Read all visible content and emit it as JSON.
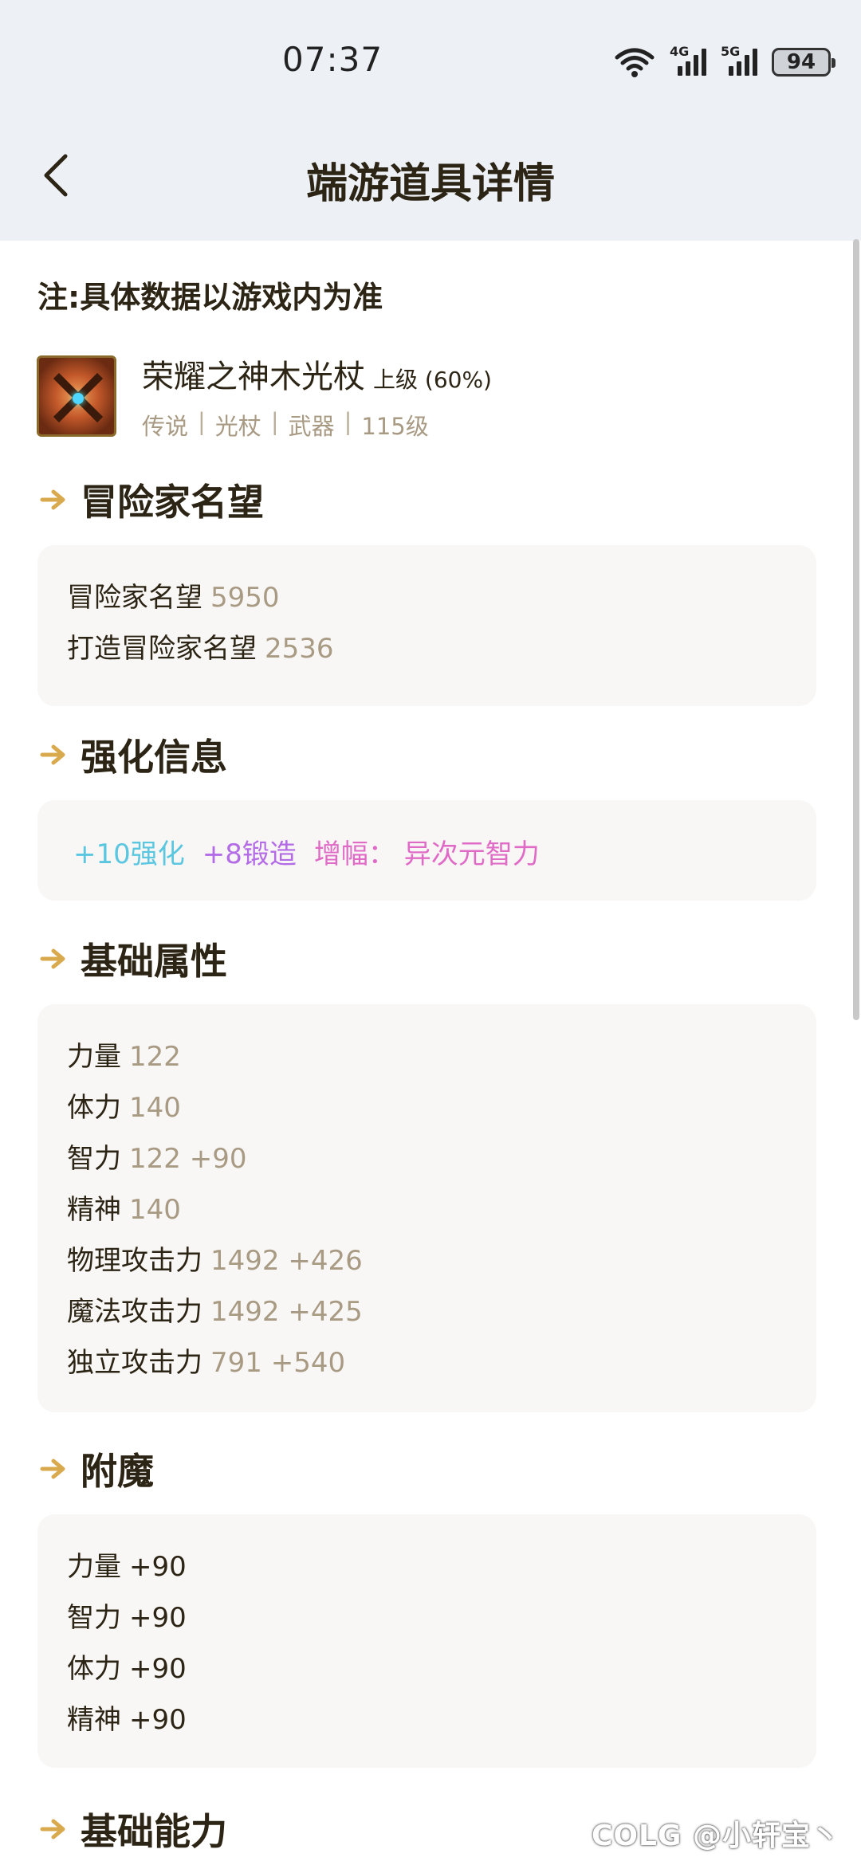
{
  "status": {
    "time": "07:37",
    "signal1_gen": "4G",
    "signal2_gen": "5G",
    "battery": "94"
  },
  "header": {
    "title": "端游道具详情"
  },
  "note": "注:具体数据以游戏内为准",
  "item": {
    "name": "荣耀之神木光杖",
    "grade": "上级 (60%)",
    "tags": [
      "传说",
      "光杖",
      "武器",
      "115级"
    ]
  },
  "sections": {
    "fame": {
      "title": "冒险家名望",
      "rows": [
        {
          "label": "冒险家名望",
          "value": "5950"
        },
        {
          "label": "打造冒险家名望",
          "value": "2536"
        }
      ]
    },
    "enhance": {
      "title": "强化信息",
      "reinforce": "+10强化",
      "forge": "+8锻造",
      "amplify": "增幅：  异次元智力"
    },
    "base": {
      "title": "基础属性",
      "rows": [
        {
          "label": "力量",
          "value": "122"
        },
        {
          "label": "体力",
          "value": "140"
        },
        {
          "label": "智力",
          "value": "122 +90"
        },
        {
          "label": "精神",
          "value": "140"
        },
        {
          "label": "物理攻击力",
          "value": "1492 +426"
        },
        {
          "label": "魔法攻击力",
          "value": "1492 +425"
        },
        {
          "label": "独立攻击力",
          "value": "791 +540"
        }
      ]
    },
    "enchant": {
      "title": "附魔",
      "rows": [
        {
          "label": "力量",
          "value": "+90"
        },
        {
          "label": "智力",
          "value": "+90"
        },
        {
          "label": "体力",
          "value": "+90"
        },
        {
          "label": "精神",
          "value": "+90"
        }
      ]
    },
    "ability": {
      "title": "基础能力"
    }
  },
  "watermark": "COLG @小轩宝丶",
  "colors": {
    "accent_arrow": "#d9a94e",
    "value_gray": "#a89a83",
    "reinforce": "#5ac6e0",
    "forge": "#b36be6",
    "amplify": "#e06bc6"
  }
}
